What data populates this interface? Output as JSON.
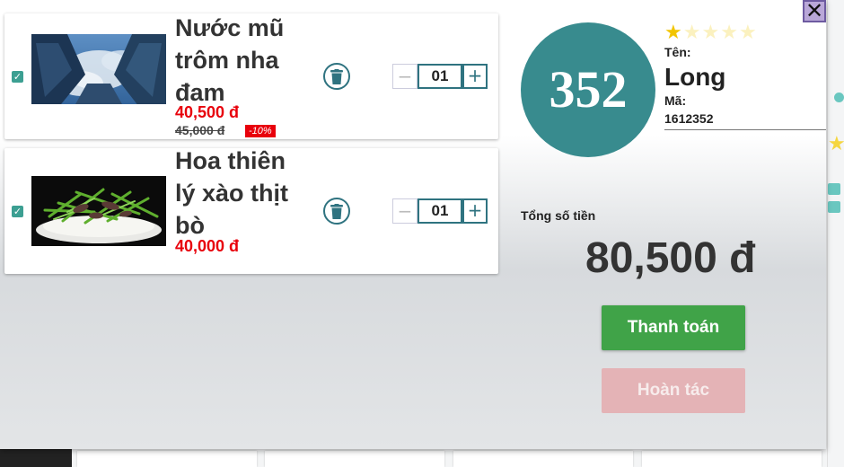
{
  "cart": {
    "items": [
      {
        "name": "Nước mũ trôm nha đam",
        "price": "40,500 đ",
        "old_price": "45,000 đ",
        "discount": "-10%",
        "quantity": "01",
        "checked": true,
        "image_icon": "city-skyline-photo"
      },
      {
        "name": "Hoa thiên lý xào thịt bò",
        "price": "40,000 đ",
        "quantity": "01",
        "checked": true,
        "image_icon": "stir-fry-dish-photo"
      }
    ],
    "close_label": "✕",
    "minus_label": "−",
    "plus_label": "+"
  },
  "user": {
    "avatar_number": "352",
    "rating": 1,
    "rating_max": 5,
    "name_label": "Tên:",
    "name": "Long",
    "id_label": "Mã:",
    "id": "1612352"
  },
  "summary": {
    "total_label": "Tổng số tiền",
    "total_value": "80,500 đ"
  },
  "actions": {
    "pay_label": "Thanh toán",
    "undo_label": "Hoàn tác"
  },
  "colors": {
    "accent": "#388b8e",
    "price": "#e8000b",
    "pay": "#40a348",
    "undo_disabled": "#e4b3b6",
    "star": "#f2c500"
  }
}
